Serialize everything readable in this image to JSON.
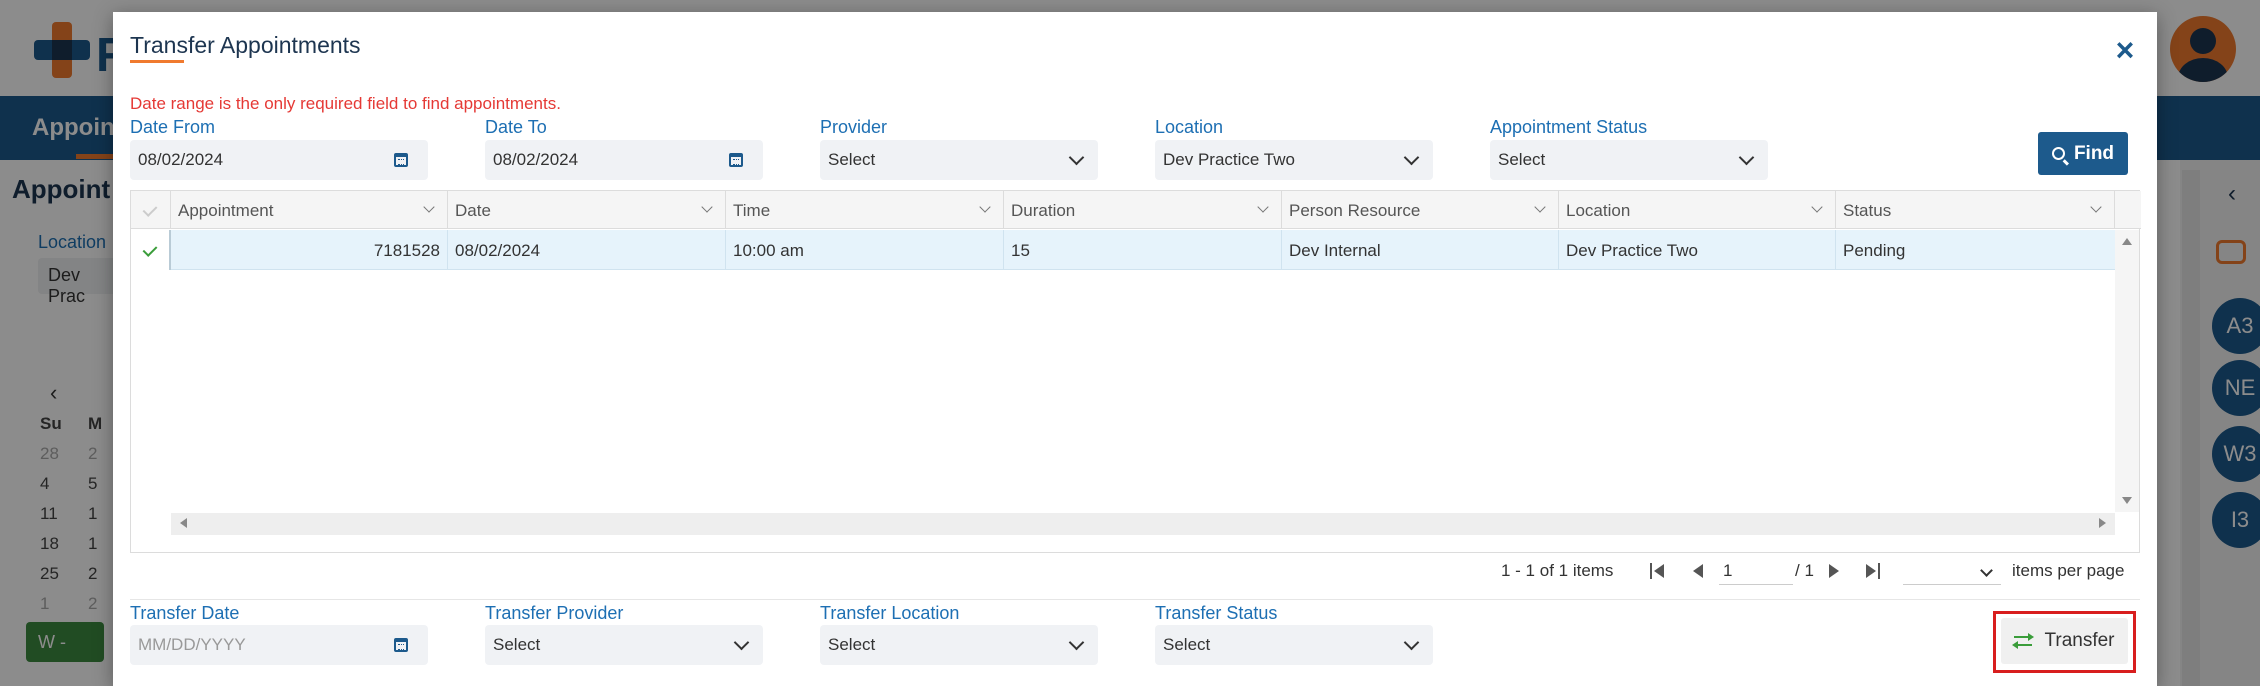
{
  "background": {
    "logo_letter": "R",
    "nav_label": "Appoin",
    "page_title": "Appoint",
    "location_label": "Location",
    "location_value": "Dev Prac",
    "calendar": {
      "header": [
        "Su",
        "M"
      ],
      "rows": [
        [
          "28",
          "2"
        ],
        [
          "4",
          "5"
        ],
        [
          "11",
          "1"
        ],
        [
          "18",
          "1"
        ],
        [
          "25",
          "2"
        ],
        [
          "1",
          "2"
        ]
      ]
    },
    "week_button": "W -",
    "rail_badges": [
      "A3",
      "NE",
      "W3",
      "I3"
    ]
  },
  "modal": {
    "title": "Transfer Appointments",
    "close_glyph": "×",
    "required_note": "Date range is the only required field to find appointments.",
    "filters": {
      "date_from": {
        "label": "Date From",
        "value": "08/02/2024"
      },
      "date_to": {
        "label": "Date To",
        "value": "08/02/2024"
      },
      "provider": {
        "label": "Provider",
        "value": "Select"
      },
      "location": {
        "label": "Location",
        "value": "Dev Practice Two"
      },
      "status": {
        "label": "Appointment Status",
        "value": "Select"
      }
    },
    "find_label": "Find",
    "grid": {
      "columns": [
        "Appointment",
        "Date",
        "Time",
        "Duration",
        "Person Resource",
        "Location",
        "Status"
      ],
      "rows": [
        {
          "appointment": "7181528",
          "date": "08/02/2024",
          "time": "10:00 am",
          "duration": "15",
          "person_resource": "Dev Internal",
          "location": "Dev Practice Two",
          "status": "Pending"
        }
      ]
    },
    "pager": {
      "info": "1 - 1 of 1 items",
      "page": "1",
      "total": "/ 1",
      "per_page_label": "items per page"
    },
    "transfer": {
      "date": {
        "label": "Transfer Date",
        "placeholder": "MM/DD/YYYY"
      },
      "provider": {
        "label": "Transfer Provider",
        "value": "Select"
      },
      "location": {
        "label": "Transfer Location",
        "value": "Select"
      },
      "status": {
        "label": "Transfer Status",
        "value": "Select"
      },
      "button_label": "Transfer"
    }
  },
  "colors": {
    "primary": "#1d5a8c",
    "accent": "#f07a2f",
    "error": "#e53935",
    "success": "#3a9d3a",
    "highlight": "#d81e1e"
  }
}
